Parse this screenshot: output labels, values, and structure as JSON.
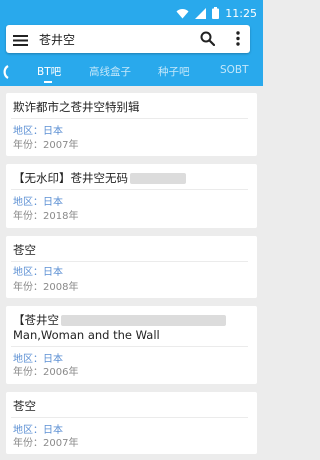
{
  "status_bar": {
    "time": "11:25",
    "icons": [
      "wifi-icon",
      "signal-icon",
      "battery-icon"
    ]
  },
  "search": {
    "query": "苍井空"
  },
  "tabs": [
    {
      "label": "BT吧"
    },
    {
      "label": "高线盒子"
    },
    {
      "label": "种子吧"
    },
    {
      "label": "SOBT"
    }
  ],
  "results": [
    {
      "title": "欺诈都市之苍井空特别辑",
      "region": "地区：日本",
      "year": "年份：2007年"
    },
    {
      "title": "【无水印】苍井空无码",
      "region": "地区：日本",
      "year": "年份：2018年"
    },
    {
      "title": "苍空",
      "region": "地区：日本",
      "year": "年份：2008年"
    },
    {
      "title": "【苍井空",
      "title_line2": "Man,Woman and the Wall",
      "region": "地区：日本",
      "year": "年份：2006年"
    },
    {
      "title": "苍空",
      "region": "地区：日本",
      "year": "年份：2007年"
    }
  ],
  "colors": {
    "accent": "#29a9ec",
    "region_text": "#5b8fd3",
    "year_text": "#8a8a8a"
  }
}
